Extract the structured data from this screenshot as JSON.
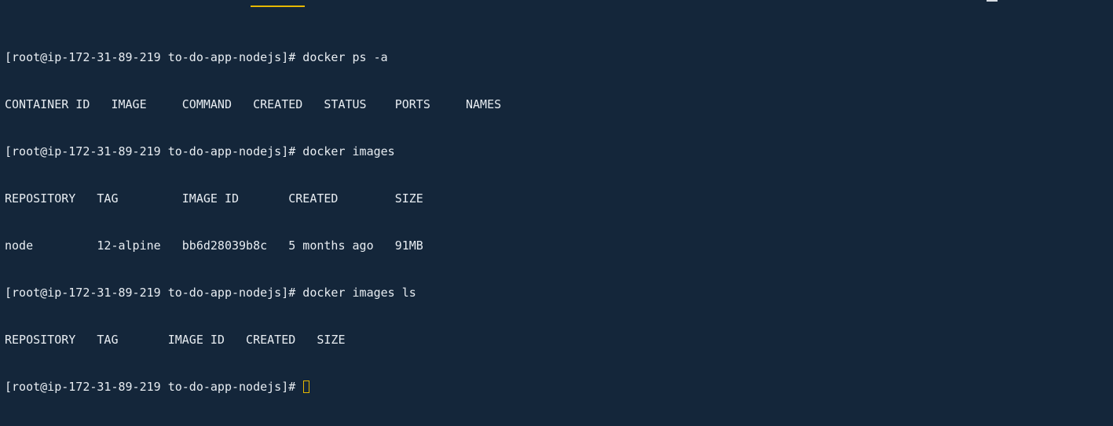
{
  "terminal": {
    "lines": [
      "[root@ip-172-31-89-219 to-do-app-nodejs]# docker ps -a",
      "CONTAINER ID   IMAGE     COMMAND   CREATED   STATUS    PORTS     NAMES",
      "[root@ip-172-31-89-219 to-do-app-nodejs]# docker images",
      "REPOSITORY   TAG         IMAGE ID       CREATED        SIZE",
      "node         12-alpine   bb6d28039b8c   5 months ago   91MB",
      "[root@ip-172-31-89-219 to-do-app-nodejs]# docker images ls",
      "REPOSITORY   TAG       IMAGE ID   CREATED   SIZE",
      "[root@ip-172-31-89-219 to-do-app-nodejs]# "
    ]
  },
  "colors": {
    "background": "#14263a",
    "text": "#e8edf2",
    "cursor": "#e6b800"
  }
}
